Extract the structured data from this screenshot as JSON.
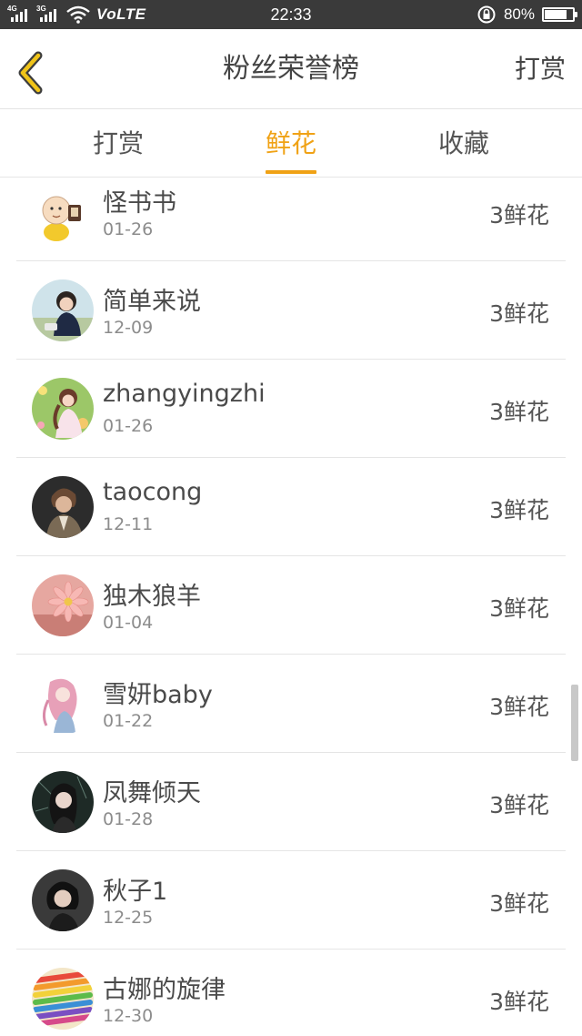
{
  "status_bar": {
    "network_1": "4G",
    "network_2": "3G",
    "volte": "VoLTE",
    "time": "22:33",
    "battery_text": "80%",
    "battery_level": 0.8
  },
  "header": {
    "title": "粉丝荣誉榜",
    "action_label": "打赏",
    "accent_color": "#f0a215"
  },
  "tabs": [
    {
      "label": "打赏",
      "active": false
    },
    {
      "label": "鲜花",
      "active": true
    },
    {
      "label": "收藏",
      "active": false
    }
  ],
  "fans": [
    {
      "name": "怪书书",
      "date": "01-26",
      "gift": "3鲜花",
      "avatar": "cartoon-monk-avatar"
    },
    {
      "name": "简单来说",
      "date": "12-09",
      "gift": "3鲜花",
      "avatar": "girl-photo-avatar"
    },
    {
      "name": "zhangyingzhi",
      "date": "01-26",
      "gift": "3鲜花",
      "avatar": "girl-in-flowers-avatar"
    },
    {
      "name": "taocong",
      "date": "12-11",
      "gift": "3鲜花",
      "avatar": "man-portrait-avatar"
    },
    {
      "name": "独木狼羊",
      "date": "01-04",
      "gift": "3鲜花",
      "avatar": "pink-flower-avatar"
    },
    {
      "name": "雪妍baby",
      "date": "01-22",
      "gift": "3鲜花",
      "avatar": "anime-girl-avatar"
    },
    {
      "name": "凤舞倾天",
      "date": "01-28",
      "gift": "3鲜花",
      "avatar": "woman-dark-avatar"
    },
    {
      "name": "秋子1",
      "date": "12-25",
      "gift": "3鲜花",
      "avatar": "woman-short-hair-avatar"
    },
    {
      "name": "古娜的旋律",
      "date": "12-30",
      "gift": "3鲜花",
      "avatar": "colored-pencils-avatar"
    }
  ]
}
